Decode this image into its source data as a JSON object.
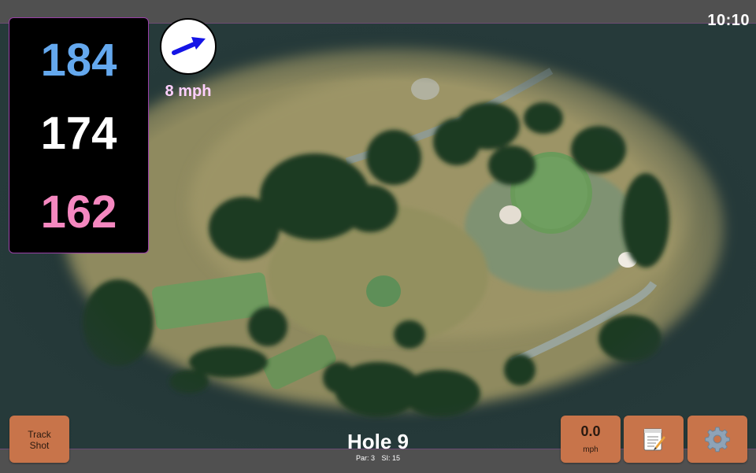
{
  "status": {
    "time": "10:10"
  },
  "yardages": {
    "back": "184",
    "middle": "174",
    "front": "162"
  },
  "colors": {
    "back": "#64a8ee",
    "middle": "#ffffff",
    "front": "#f588c0",
    "button": "#c8744a",
    "wind_arrow": "#1414e6"
  },
  "wind": {
    "speed": "8 mph",
    "direction_icon": "arrow-east-northeast-icon"
  },
  "hole": {
    "title": "Hole 9",
    "par": "Par: 3",
    "stroke_index": "SI: 15"
  },
  "buttons": {
    "track_shot_line1": "Track",
    "track_shot_line2": "Shot",
    "speed_value": "0.0",
    "speed_unit": "mph",
    "notes_icon": "notepad-icon",
    "settings_icon": "gear-icon"
  }
}
